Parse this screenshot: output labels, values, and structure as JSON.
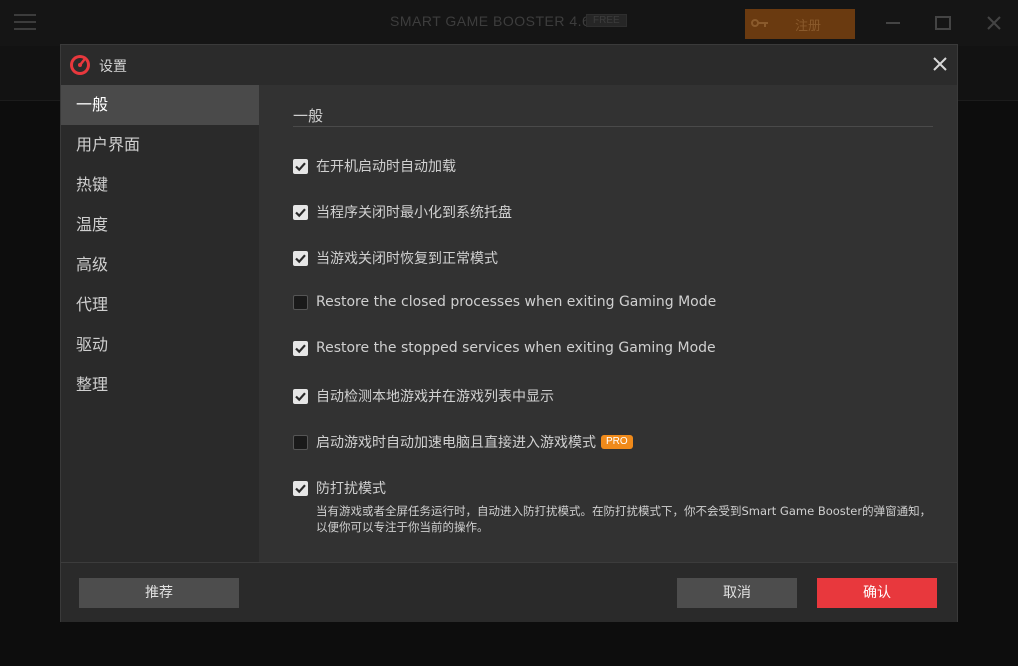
{
  "app": {
    "title": "SMART GAME BOOSTER 4.6",
    "edition_badge": "FREE",
    "register_label": "注册"
  },
  "dialog": {
    "title": "设置"
  },
  "sidebar": {
    "items": [
      {
        "label": "一般",
        "active": true
      },
      {
        "label": "用户界面"
      },
      {
        "label": "热键"
      },
      {
        "label": "温度"
      },
      {
        "label": "高级"
      },
      {
        "label": "代理"
      },
      {
        "label": "驱动"
      },
      {
        "label": "整理"
      }
    ]
  },
  "general": {
    "section_title": "一般",
    "options": [
      {
        "label": "在开机启动时自动加载",
        "checked": true
      },
      {
        "label": "当程序关闭时最小化到系统托盘",
        "checked": true
      },
      {
        "label": "当游戏关闭时恢复到正常模式",
        "checked": true
      },
      {
        "label": "Restore the closed processes when exiting Gaming Mode",
        "checked": false
      },
      {
        "label": "Restore the stopped services when exiting Gaming Mode",
        "checked": true
      },
      {
        "label": "自动检测本地游戏并在游戏列表中显示",
        "checked": true
      },
      {
        "label": "启动游戏时自动加速电脑且直接进入游戏模式",
        "checked": false,
        "badge": "PRO"
      },
      {
        "label": "防打扰模式",
        "checked": true
      }
    ],
    "do_not_disturb_desc": "当有游戏或者全屏任务运行时，自动进入防打扰模式。在防打扰模式下，你不会受到Smart Game Booster的弹窗通知，以便你可以专注于你当前的操作。"
  },
  "footer": {
    "recommend_label": "推荐",
    "cancel_label": "取消",
    "ok_label": "确认"
  },
  "colors": {
    "accent_red": "#e8383d",
    "pro_orange": "#f08a1a",
    "sidebar_active": "#4a4a4a"
  }
}
